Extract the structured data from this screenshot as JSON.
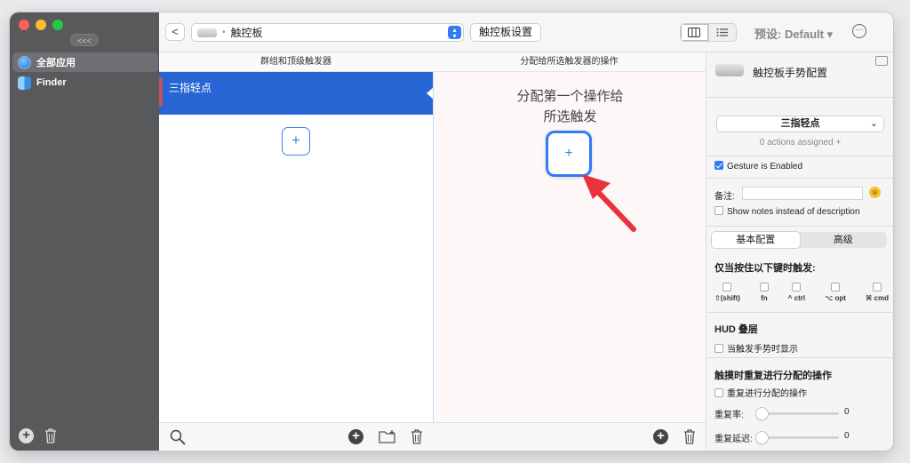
{
  "sidebar": {
    "collapse_label": "<<<",
    "items": [
      {
        "label": "全部应用",
        "icon": "globe-icon",
        "active": true
      },
      {
        "label": "Finder",
        "icon": "finder-icon",
        "active": false
      }
    ]
  },
  "toolbar": {
    "back_label": "<",
    "device_select": "触控板",
    "device_settings_label": "触控板设置",
    "preset_label": "预设: Default ▾",
    "more_label": "···"
  },
  "columns": {
    "col1_header": "群组和顶级触发器",
    "col2_header": "分配给所选触发器的操作",
    "trigger_label": "三指轻点",
    "add_label": "+",
    "placeholder_line1": "分配第一个操作给",
    "placeholder_line2": "所选触发"
  },
  "inspector": {
    "title": "触控板手势配置",
    "trigger_select": "三指轻点",
    "assigned_text": "0 actions assigned +",
    "gesture_enabled_label": "Gesture is Enabled",
    "gesture_enabled": true,
    "notes_label": "备注:",
    "notes_value": "",
    "show_notes_label": "Show notes instead of description",
    "tabs": [
      "基本配置",
      "高级"
    ],
    "modifier_heading": "仅当按住以下键时触发:",
    "modifiers": [
      "⇧(shift)",
      "fn",
      "^ ctrl",
      "⌥ opt",
      "⌘ cmd"
    ],
    "hud_heading": "HUD 叠层",
    "hud_label": "当触发手势时显示",
    "repeat_heading": "触摸时重复进行分配的操作",
    "repeat_label": "重复进行分配的操作",
    "repeat_rate_label": "重复率:",
    "repeat_rate_value": "0",
    "repeat_delay_label": "重复延迟:",
    "repeat_delay_value": "0"
  },
  "colors": {
    "accent": "#2f7cf6",
    "selection": "#2866d6",
    "arrow": "#e8323c"
  }
}
